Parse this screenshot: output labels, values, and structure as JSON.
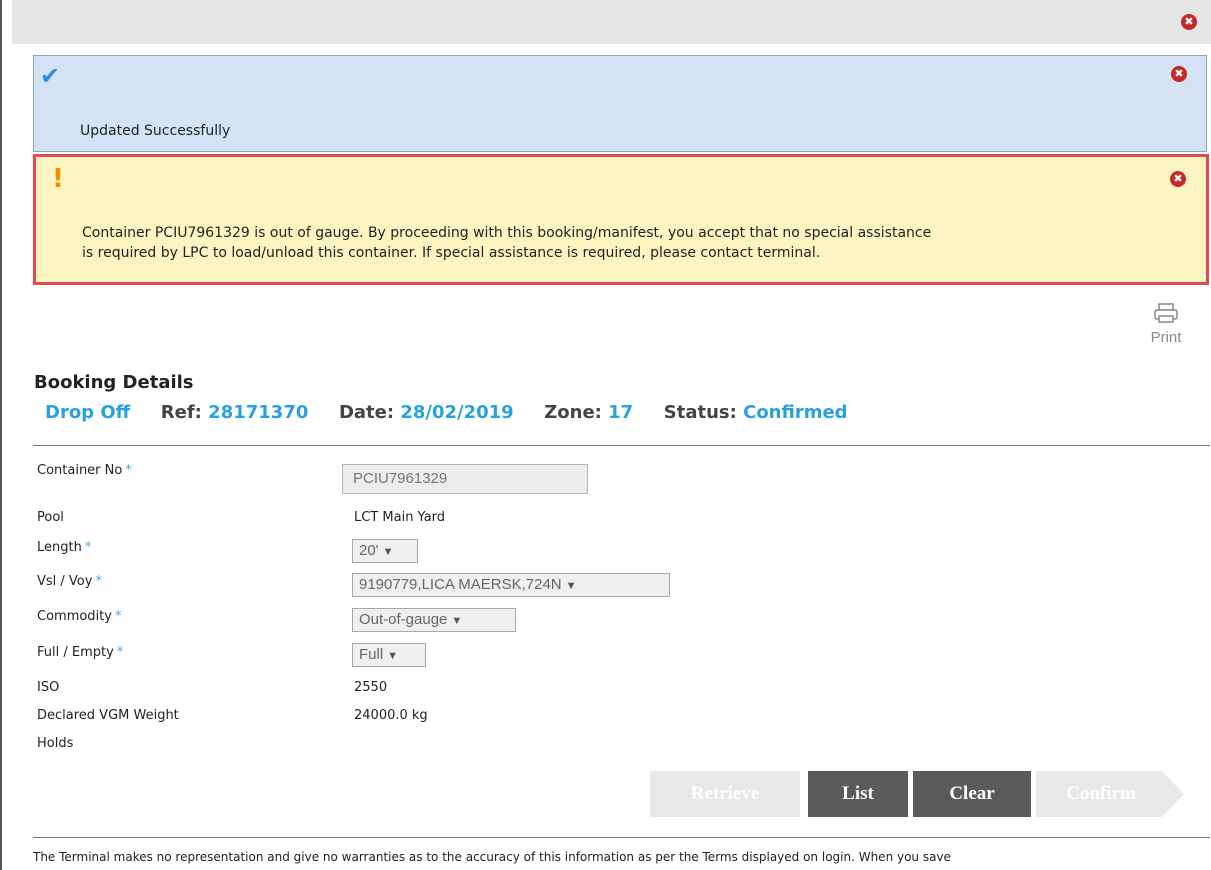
{
  "alerts": {
    "success": {
      "icon": "check-icon",
      "message": "Updated Successfully"
    },
    "warning": {
      "icon": "exclamation-icon",
      "message_line1": "Container PCIU7961329 is out of gauge. By proceeding with this booking/manifest, you accept that no special assistance",
      "message_line2": "is required by LPC to load/unload this container. If special assistance is required, please contact terminal."
    },
    "close_icon": "close-icon",
    "close_glyph": "✖"
  },
  "print": {
    "label": "Print",
    "icon": "printer-icon"
  },
  "booking": {
    "title": "Booking Details",
    "type": "Drop Off",
    "ref_label": "Ref:",
    "ref": "28171370",
    "date_label": "Date:",
    "date": "28/02/2019",
    "zone_label": "Zone:",
    "zone": "17",
    "status_label": "Status:",
    "status": "Confirmed"
  },
  "form": {
    "required_mark": "*",
    "container_no": {
      "label": "Container No",
      "value": "PCIU7961329"
    },
    "pool": {
      "label": "Pool",
      "value": "LCT Main Yard"
    },
    "length": {
      "label": "Length",
      "value": "20'"
    },
    "vsl_voy": {
      "label": "Vsl / Voy",
      "value": "9190779,LICA MAERSK,724N"
    },
    "commodity": {
      "label": "Commodity",
      "value": "Out-of-gauge"
    },
    "full_empty": {
      "label": "Full / Empty",
      "value": "Full"
    },
    "iso": {
      "label": "ISO",
      "value": "2550"
    },
    "vgm": {
      "label": "Declared VGM Weight",
      "value": "24000.0 kg"
    },
    "holds": {
      "label": "Holds",
      "value": ""
    }
  },
  "buttons": {
    "retrieve": "Retrieve",
    "list": "List",
    "clear": "Clear",
    "confirm": "Confirm"
  },
  "footer": {
    "text": "The Terminal makes no representation and give no warranties as to the accuracy of this information as per the Terms displayed on login. When you save"
  },
  "colors": {
    "accent": "#29a0e0",
    "success_bg": "#d4e2f4",
    "warning_bg": "#fcf5c2",
    "warning_border": "#e5484d",
    "button_dark": "#5a5a5a"
  }
}
